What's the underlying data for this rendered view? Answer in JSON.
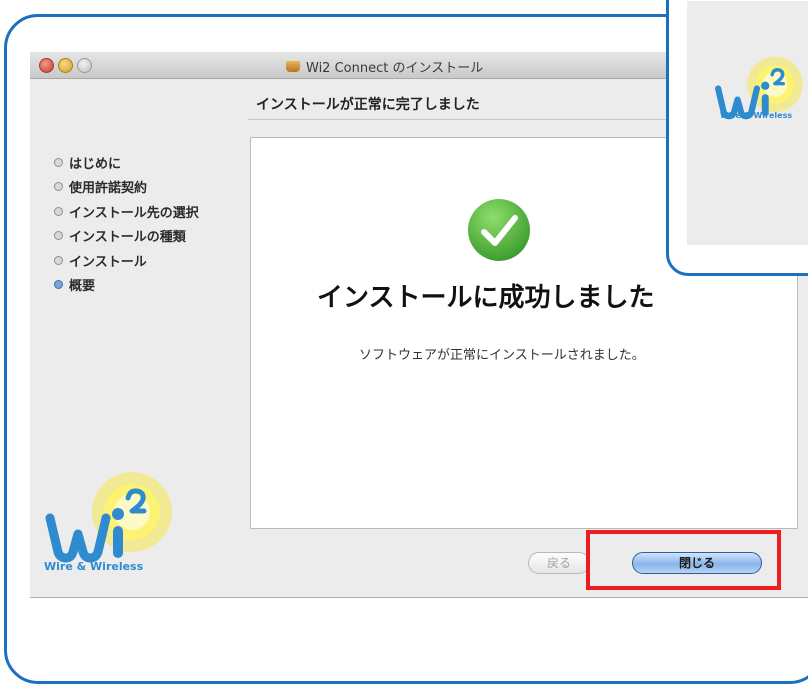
{
  "window": {
    "title": "Wi2 Connect のインストール",
    "subtitle": "インストールが正常に完了しました"
  },
  "sidebar": {
    "steps": [
      {
        "label": "はじめに",
        "active": false
      },
      {
        "label": "使用許諾契約",
        "active": false
      },
      {
        "label": "インストール先の選択",
        "active": false
      },
      {
        "label": "インストールの種類",
        "active": false
      },
      {
        "label": "インストール",
        "active": false
      },
      {
        "label": "概要",
        "active": true
      }
    ]
  },
  "content": {
    "status_icon": "checkmark-icon",
    "heading": "インストールに成功しました",
    "message": "ソフトウェアが正常にインストールされました。"
  },
  "buttons": {
    "back_label": "戻る",
    "close_label": "閉じる"
  },
  "brand": {
    "tagline": "Wire & Wireless",
    "logo_icon": "wi2-logo-icon"
  },
  "colors": {
    "frame_blue": "#1d6fc0",
    "highlight_red": "#ee1c1c",
    "check_green": "#4fb33f",
    "logo_yellow": "#f6e84a",
    "logo_blue": "#2e8bd0"
  }
}
